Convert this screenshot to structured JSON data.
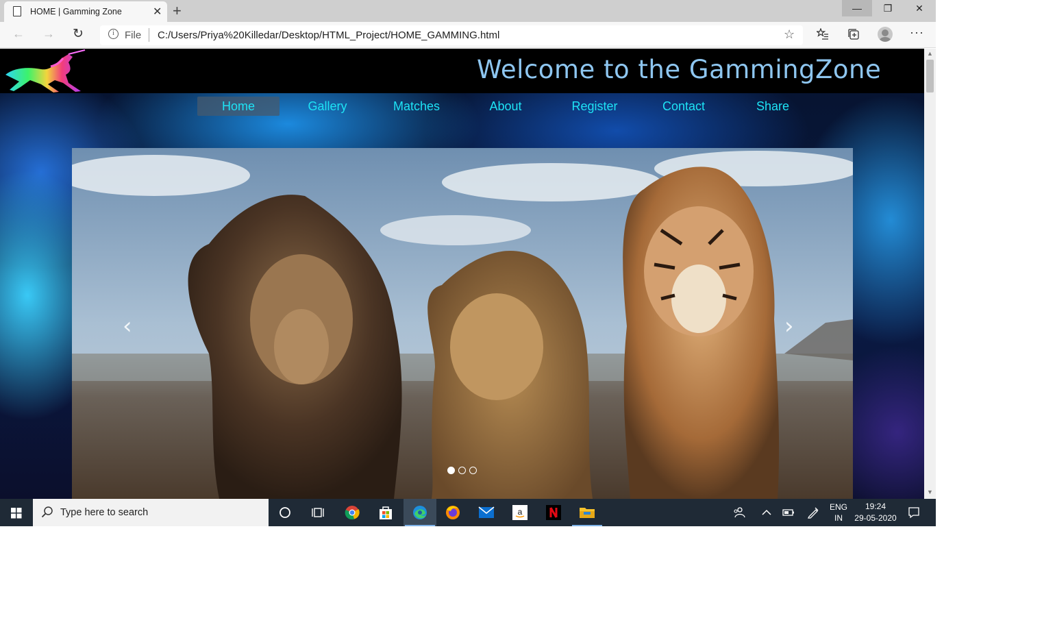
{
  "browser": {
    "tab_title": "HOME | Gamming Zone",
    "tab_close": "✕",
    "new_tab": "+",
    "window": {
      "minimize": "—",
      "maximize": "❐",
      "close": "✕"
    },
    "nav": {
      "back": "←",
      "forward": "→",
      "reload": "↻"
    },
    "address": {
      "info": "i",
      "scheme": "File",
      "url": "C:/Users/Priya%20Killedar/Desktop/HTML_Project/HOME_GAMMING.html",
      "favorite": "☆"
    },
    "more": "···"
  },
  "page": {
    "title": "Welcome to the GammingZone",
    "nav_items": [
      "Home",
      "Gallery",
      "Matches",
      "About",
      "Register",
      "Contact",
      "Share"
    ],
    "active_nav": "Home",
    "carousel": {
      "prev": "‹",
      "next": "›",
      "slides": 3,
      "active_slide": 1
    }
  },
  "taskbar": {
    "search_placeholder": "Type here to search",
    "lang_top": "ENG",
    "lang_bottom": "IN",
    "time": "19:24",
    "date": "29-05-2020"
  },
  "colors": {
    "nav_text": "#1ee3f5",
    "title_text": "#8ec6f0",
    "taskbar": "#1f2a36"
  }
}
